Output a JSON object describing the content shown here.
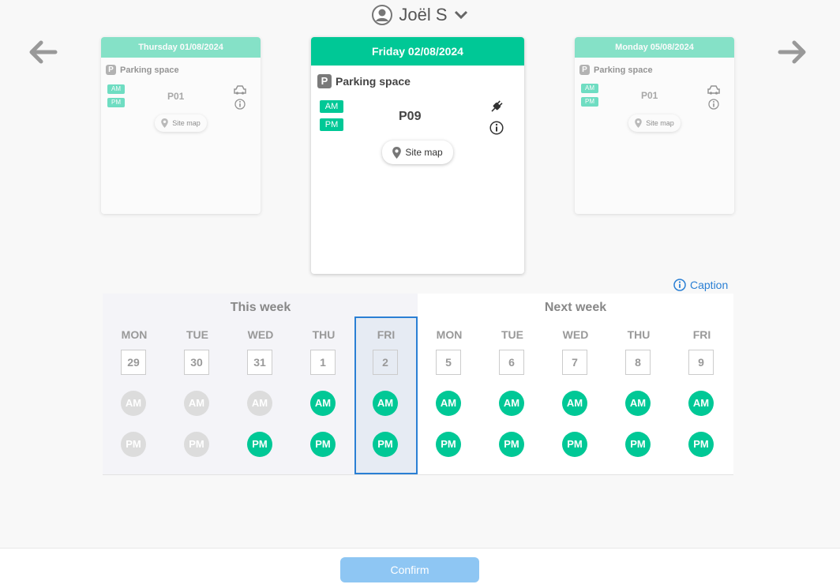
{
  "user": {
    "name": "Joël S"
  },
  "cards": {
    "prev": {
      "date": "Thursday 01/08/2024",
      "title": "Parking space",
      "badge": "P",
      "am": "AM",
      "pm": "PM",
      "spot": "P01",
      "sitemap": "Site map"
    },
    "current": {
      "date": "Friday 02/08/2024",
      "title": "Parking space",
      "badge": "P",
      "am": "AM",
      "pm": "PM",
      "spot": "P09",
      "sitemap": "Site map"
    },
    "next": {
      "date": "Monday 05/08/2024",
      "title": "Parking space",
      "badge": "P",
      "am": "AM",
      "pm": "PM",
      "spot": "P01",
      "sitemap": "Site map"
    }
  },
  "caption": "Caption",
  "calendar": {
    "this_week": {
      "title": "This week",
      "days": [
        {
          "name": "MON",
          "num": "29",
          "am": "AM",
          "pm": "PM",
          "am_on": false,
          "pm_on": false
        },
        {
          "name": "TUE",
          "num": "30",
          "am": "AM",
          "pm": "PM",
          "am_on": false,
          "pm_on": false
        },
        {
          "name": "WED",
          "num": "31",
          "am": "AM",
          "pm": "PM",
          "am_on": false,
          "pm_on": true
        },
        {
          "name": "THU",
          "num": "1",
          "am": "AM",
          "pm": "PM",
          "am_on": true,
          "pm_on": true
        },
        {
          "name": "FRI",
          "num": "2",
          "am": "AM",
          "pm": "PM",
          "am_on": true,
          "pm_on": true,
          "selected": true
        }
      ]
    },
    "next_week": {
      "title": "Next week",
      "days": [
        {
          "name": "MON",
          "num": "5",
          "am": "AM",
          "pm": "PM",
          "am_on": true,
          "pm_on": true
        },
        {
          "name": "TUE",
          "num": "6",
          "am": "AM",
          "pm": "PM",
          "am_on": true,
          "pm_on": true
        },
        {
          "name": "WED",
          "num": "7",
          "am": "AM",
          "pm": "PM",
          "am_on": true,
          "pm_on": true
        },
        {
          "name": "THU",
          "num": "8",
          "am": "AM",
          "pm": "PM",
          "am_on": true,
          "pm_on": true
        },
        {
          "name": "FRI",
          "num": "9",
          "am": "AM",
          "pm": "PM",
          "am_on": true,
          "pm_on": true
        }
      ]
    }
  },
  "footer": {
    "confirm": "Confirm"
  },
  "colors": {
    "accent": "#00c896",
    "selected_border": "#2a7fd4",
    "confirm_disabled": "#8ec6f3",
    "slot_off": "#dcdcdc"
  }
}
